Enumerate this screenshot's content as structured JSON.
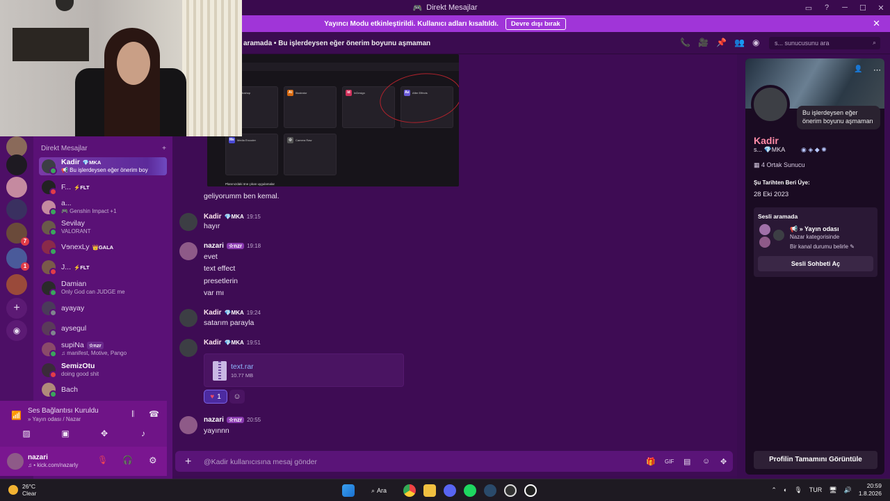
{
  "window": {
    "title": "Direkt Mesajlar",
    "controls": [
      "─",
      "☐",
      "✕"
    ]
  },
  "banner": {
    "text": "Yayıncı Modu etkinleştirildi. Kullanıcı adları kısaltıldı.",
    "button": "Devre dışı bırak"
  },
  "header": {
    "title": "aramada  • Bu işlerdeysen eğer önerim boyunu aşmaman",
    "search_placeholder": "s... sunucusunu ara"
  },
  "servers": {
    "badges": [
      "7",
      "1"
    ]
  },
  "dm_list": {
    "heading": "Direkt Mesajlar",
    "items": [
      {
        "name": "Kadir",
        "tag": "💎MKA",
        "sub": "📢 Bu işlerdeysen eğer önerim boy"
      },
      {
        "name": "F...",
        "tag": "⚡FLT",
        "sub": ""
      },
      {
        "name": "a...",
        "tag": "",
        "sub": "🎮 Genshin Impact +1"
      },
      {
        "name": "Sevilay",
        "tag": "",
        "sub": "VALORANT"
      },
      {
        "name": "VɘnexLy",
        "tag": "👑GALA",
        "sub": ""
      },
      {
        "name": "J...",
        "tag": "⚡FLT",
        "sub": ""
      },
      {
        "name": "Damian",
        "tag": "",
        "sub": "Only God can JUDGE me"
      },
      {
        "name": "ayayay",
        "tag": "",
        "sub": ""
      },
      {
        "name": "aysegul",
        "tag": "",
        "sub": ""
      },
      {
        "name": "supiNa",
        "tag": "☆nzr",
        "sub": "♫ manifest, Motive, Pango"
      },
      {
        "name": "SemizOtu",
        "tag": "",
        "sub": "doing good shit"
      },
      {
        "name": "Bach",
        "tag": "",
        "sub": ""
      }
    ]
  },
  "voice": {
    "status": "Ses Bağlantısı Kuruldu",
    "channel": "» Yayın odası / Nazar"
  },
  "user": {
    "name": "nazari",
    "sub": "♫ • kick.com/nazarly"
  },
  "screenshot": {
    "cards": [
      "Photoshop",
      "Illustrator",
      "InDesign",
      "After Effects",
      "Media Encoder",
      "Camera Raw"
    ],
    "footer": "Planınızdaki öne çıkan uygulamalar"
  },
  "messages": [
    {
      "text": "geliyorumm ben kemal."
    },
    {
      "author": "Kadir",
      "tag": "💎MKA",
      "time": "19:15",
      "lines": [
        "hayır"
      ]
    },
    {
      "author": "nazari",
      "tag": "☆nzr",
      "time": "19:18",
      "lines": [
        "evet",
        "text effect",
        "presetlerin",
        "var mı"
      ]
    },
    {
      "author": "Kadir",
      "tag": "💎MKA",
      "time": "19:24",
      "lines": [
        "satarım parayla"
      ]
    },
    {
      "author": "Kadir",
      "tag": "💎MKA",
      "time": "19:51",
      "file": {
        "name": "text.rar",
        "size": "10.77 MB"
      },
      "reaction": {
        "emoji": "♥",
        "count": "1"
      }
    },
    {
      "author": "nazari",
      "tag": "☆nzr",
      "time": "20:55",
      "lines": [
        "yayınnn"
      ]
    }
  ],
  "composer": {
    "placeholder": "@Kadir kullanıcısına mesaj gönder"
  },
  "profile": {
    "status_bubble": "Bu işlerdeysen eğer önerim boyunu aşmaman",
    "display_name": "Kadir",
    "username": "s...   💎MKA",
    "mutual": "4 Ortak Sunucu",
    "since_heading": "Şu Tarihten Beri Üye:",
    "since": "28 Eki 2023",
    "voice_heading": "Sesli aramada",
    "room": "📢 » Yayın odası",
    "category": "Nazar kategorisinde",
    "room_status": "Bir kanal durumu belirle ✎",
    "join": "Sesli Sohbeti Aç",
    "view_full": "Profilin Tamamını Görüntüle"
  },
  "taskbar": {
    "weather_temp": "26°C",
    "weather_desc": "Clear",
    "search": "Ara",
    "lang": "TUR",
    "time": "20:59",
    "date": "1.8.2026"
  }
}
